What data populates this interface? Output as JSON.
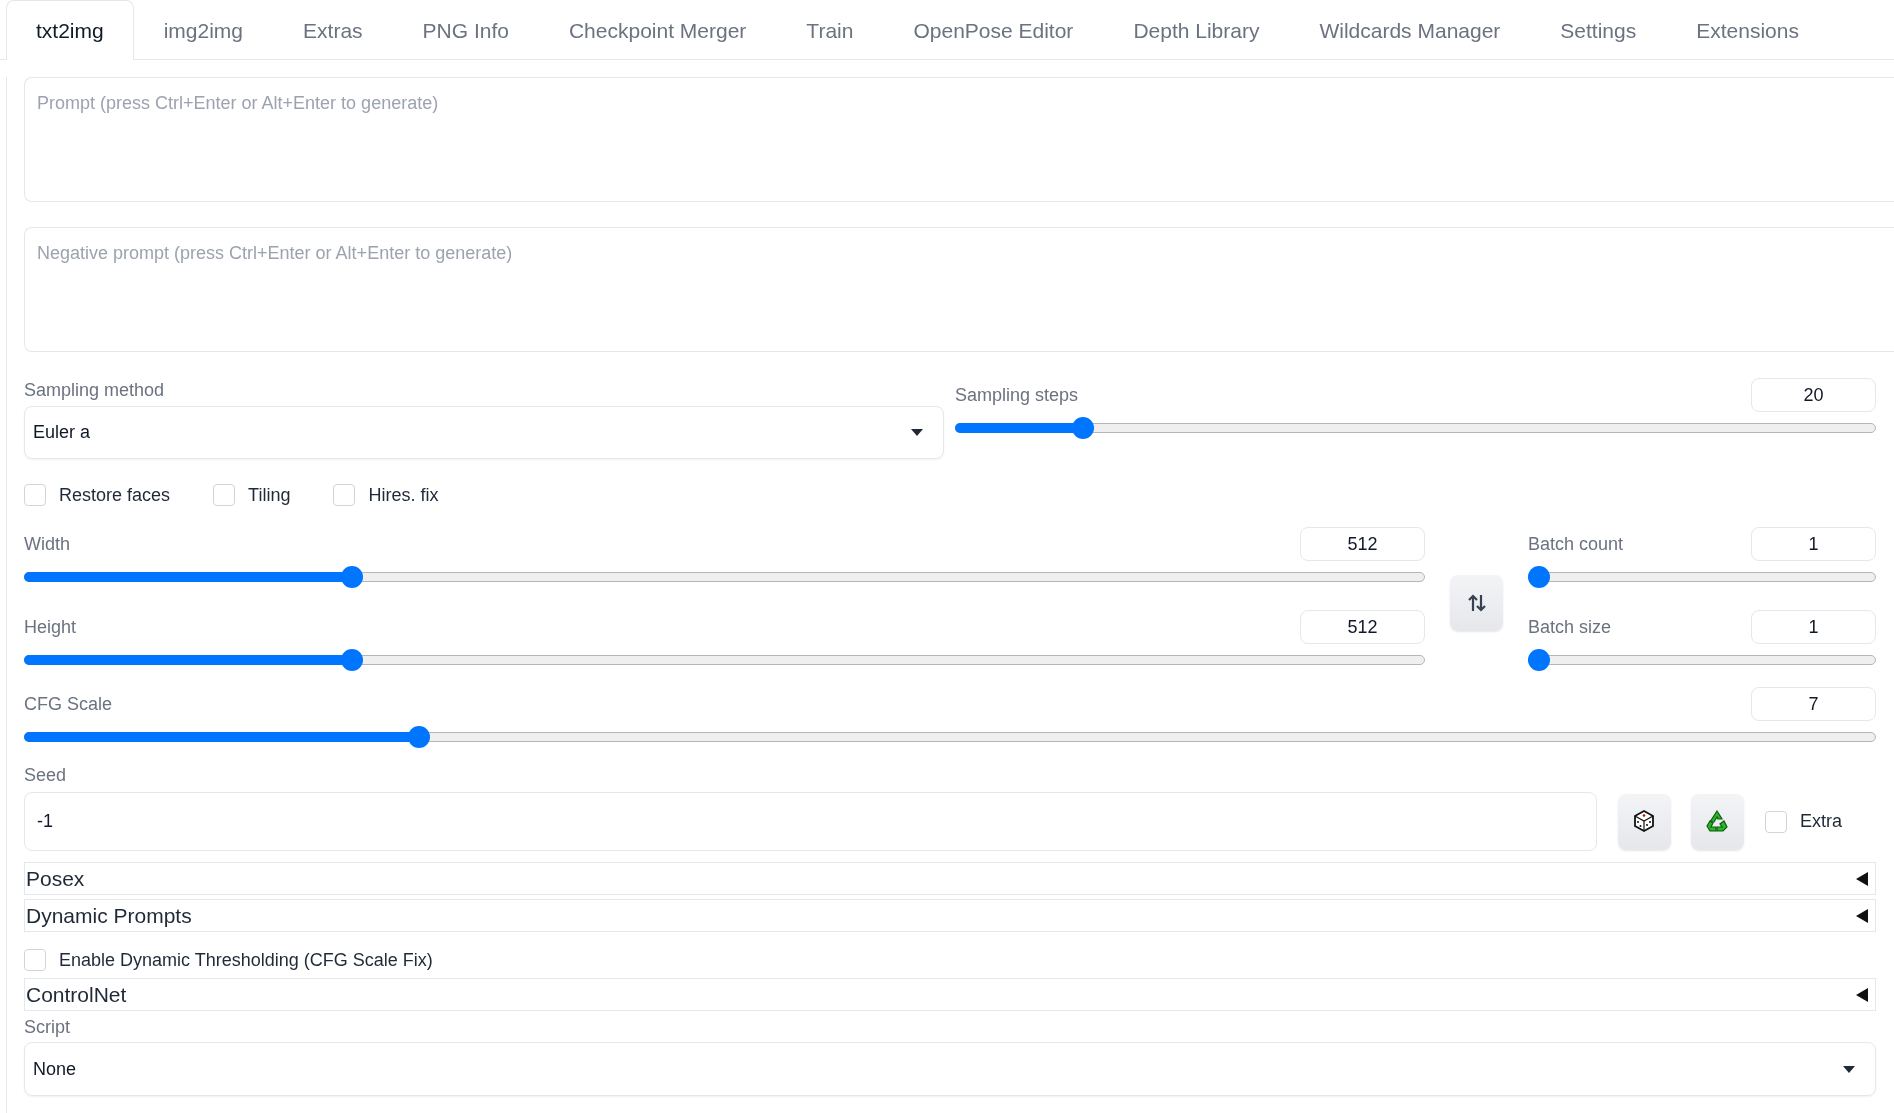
{
  "tabs": [
    {
      "label": "txt2img",
      "selected": true
    },
    {
      "label": "img2img",
      "selected": false
    },
    {
      "label": "Extras",
      "selected": false
    },
    {
      "label": "PNG Info",
      "selected": false
    },
    {
      "label": "Checkpoint Merger",
      "selected": false
    },
    {
      "label": "Train",
      "selected": false
    },
    {
      "label": "OpenPose Editor",
      "selected": false
    },
    {
      "label": "Depth Library",
      "selected": false
    },
    {
      "label": "Wildcards Manager",
      "selected": false
    },
    {
      "label": "Settings",
      "selected": false
    },
    {
      "label": "Extensions",
      "selected": false
    }
  ],
  "prompt": {
    "placeholder": "Prompt (press Ctrl+Enter or Alt+Enter to generate)"
  },
  "negative_prompt": {
    "placeholder": "Negative prompt (press Ctrl+Enter or Alt+Enter to generate)"
  },
  "sampling_method": {
    "label": "Sampling method",
    "value": "Euler a"
  },
  "sampling_steps": {
    "label": "Sampling steps",
    "value": "20",
    "level": 0.13
  },
  "options": [
    {
      "label": "Restore faces",
      "checked": false
    },
    {
      "label": "Tiling",
      "checked": false
    },
    {
      "label": "Hires. fix",
      "checked": false
    }
  ],
  "width": {
    "label": "Width",
    "value": "512",
    "level": 0.23
  },
  "height": {
    "label": "Height",
    "value": "512",
    "level": 0.23
  },
  "batch_count": {
    "label": "Batch count",
    "value": "1",
    "level": 0
  },
  "batch_size": {
    "label": "Batch size",
    "value": "1",
    "level": 0
  },
  "cfg_scale": {
    "label": "CFG Scale",
    "value": "7",
    "level": 0.21
  },
  "seed": {
    "label": "Seed",
    "value": "-1"
  },
  "extra": {
    "label": "Extra",
    "checked": false
  },
  "sections": [
    {
      "kind": "accordion",
      "label": "Posex",
      "expanded": false
    },
    {
      "kind": "accordion",
      "label": "Dynamic Prompts",
      "expanded": false
    },
    {
      "kind": "checkbox",
      "label": "Enable Dynamic Thresholding (CFG Scale Fix)",
      "checked": false
    },
    {
      "kind": "accordion",
      "label": "ControlNet",
      "expanded": false
    }
  ],
  "script": {
    "label": "Script",
    "value": "None"
  }
}
